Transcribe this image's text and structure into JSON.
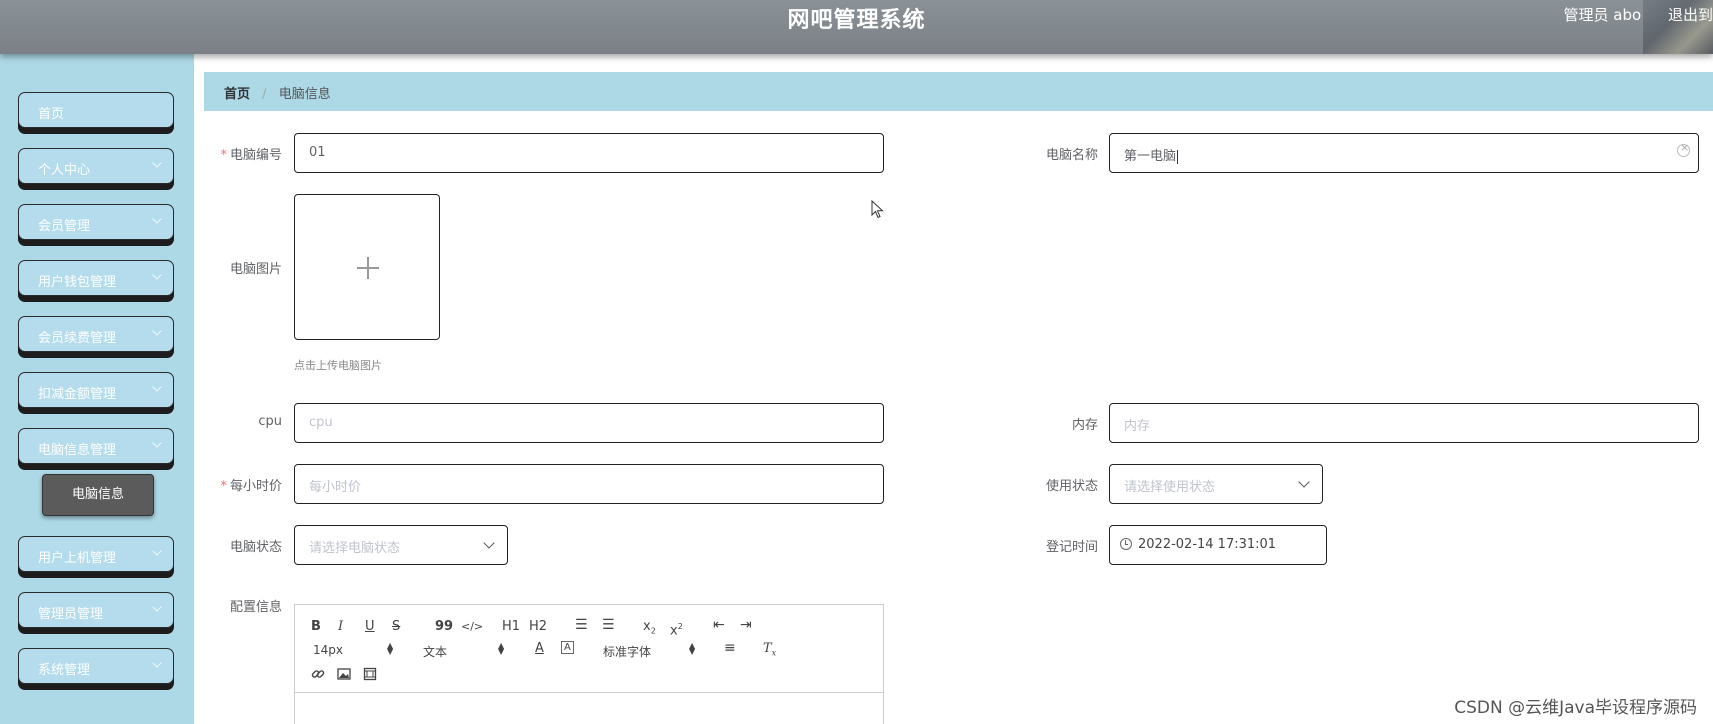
{
  "header": {
    "title": "网吧管理系统",
    "user_label": "管理员 abo",
    "logout_label": "退出到"
  },
  "sidebar": {
    "items": [
      {
        "label": "首页",
        "has_arrow": false
      },
      {
        "label": "个人中心",
        "has_arrow": true
      },
      {
        "label": "会员管理",
        "has_arrow": true
      },
      {
        "label": "用户钱包管理",
        "has_arrow": true
      },
      {
        "label": "会员续费管理",
        "has_arrow": true
      },
      {
        "label": "扣减金额管理",
        "has_arrow": true
      },
      {
        "label": "电脑信息管理",
        "has_arrow": true
      },
      {
        "label": "用户上机管理",
        "has_arrow": true
      },
      {
        "label": "管理员管理",
        "has_arrow": true
      },
      {
        "label": "系统管理",
        "has_arrow": true
      }
    ],
    "active_sub": "电脑信息"
  },
  "breadcrumb": {
    "home": "首页",
    "separator": "/",
    "current": "电脑信息"
  },
  "form": {
    "computer_no": {
      "label": "电脑编号",
      "value": "01",
      "required": true
    },
    "computer_name": {
      "label": "电脑名称",
      "value": "第一电脑"
    },
    "computer_image": {
      "label": "电脑图片",
      "hint": "点击上传电脑图片"
    },
    "cpu": {
      "label": "cpu",
      "placeholder": "cpu"
    },
    "memory": {
      "label": "内存",
      "placeholder": "内存"
    },
    "hourly_price": {
      "label": "每小时价",
      "placeholder": "每小时价",
      "required": true
    },
    "usage_status": {
      "label": "使用状态",
      "placeholder": "请选择使用状态"
    },
    "computer_status": {
      "label": "电脑状态",
      "placeholder": "请选择电脑状态"
    },
    "register_time": {
      "label": "登记时间",
      "value": "2022-02-14 17:31:01"
    },
    "config_info": {
      "label": "配置信息"
    }
  },
  "editor": {
    "font_size": "14px",
    "text_style": "文本",
    "font_family": "标准字体",
    "h1": "H1",
    "h2": "H2",
    "quote": "99",
    "code": "</>"
  },
  "watermark": "CSDN @云维Java毕设程序源码",
  "colors": {
    "sidebar_bg": "#add8e6",
    "header_bg": "#808890",
    "required": "#f56c6c"
  }
}
